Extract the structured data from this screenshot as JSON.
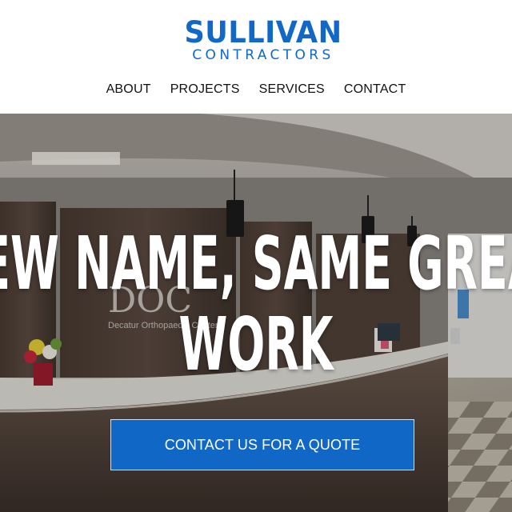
{
  "header": {
    "logo": {
      "name": "SULLIVAN",
      "tagline": "CONTRACTORS",
      "color": "#1168c7"
    },
    "nav": [
      {
        "label": "ABOUT"
      },
      {
        "label": "PROJECTS"
      },
      {
        "label": "SERVICES"
      },
      {
        "label": "CONTACT"
      }
    ]
  },
  "hero": {
    "headline_line1": "NEW NAME, SAME GREAT",
    "headline_line2": "WORK",
    "background_scene": {
      "signage_logo": "DOC",
      "signage_text": "Decatur Orthopaedic Center"
    },
    "cta_label": "CONTACT US FOR A QUOTE",
    "cta_color": "#1167c5"
  }
}
